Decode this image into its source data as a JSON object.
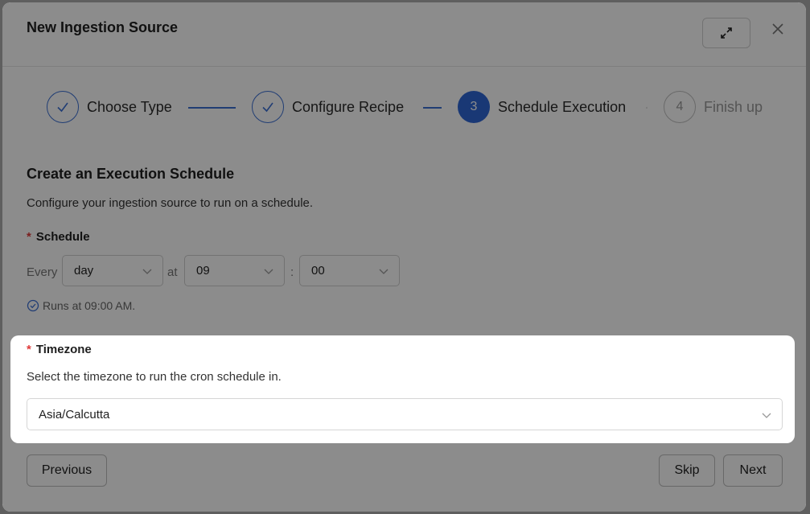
{
  "modal": {
    "title": "New Ingestion Source",
    "expand_icon": "expand-icon",
    "close_icon": "close-icon"
  },
  "steps": [
    {
      "label": "Choose Type",
      "status": "done",
      "number": ""
    },
    {
      "label": "Configure Recipe",
      "status": "done",
      "number": ""
    },
    {
      "label": "Schedule Execution",
      "status": "active",
      "number": "3"
    },
    {
      "label": "Finish up",
      "status": "todo",
      "number": "4"
    }
  ],
  "schedule_section": {
    "title": "Create an Execution Schedule",
    "description": "Configure your ingestion source to run on a schedule.",
    "required_marker": "*",
    "label": "Schedule",
    "every_label": "Every",
    "frequency_value": "day",
    "at_label": "at",
    "hour_value": "09",
    "colon": ":",
    "minute_value": "00",
    "runs_text": "Runs at 09:00 AM."
  },
  "timezone_section": {
    "required_marker": "*",
    "label": "Timezone",
    "description": "Select the timezone to run the cron schedule in.",
    "value": "Asia/Calcutta"
  },
  "footer": {
    "previous_label": "Previous",
    "skip_label": "Skip",
    "next_label": "Next"
  },
  "colors": {
    "accent": "#2f66d6",
    "required": "#e03a3a",
    "overlay": "rgba(0,0,0,0.45)"
  }
}
